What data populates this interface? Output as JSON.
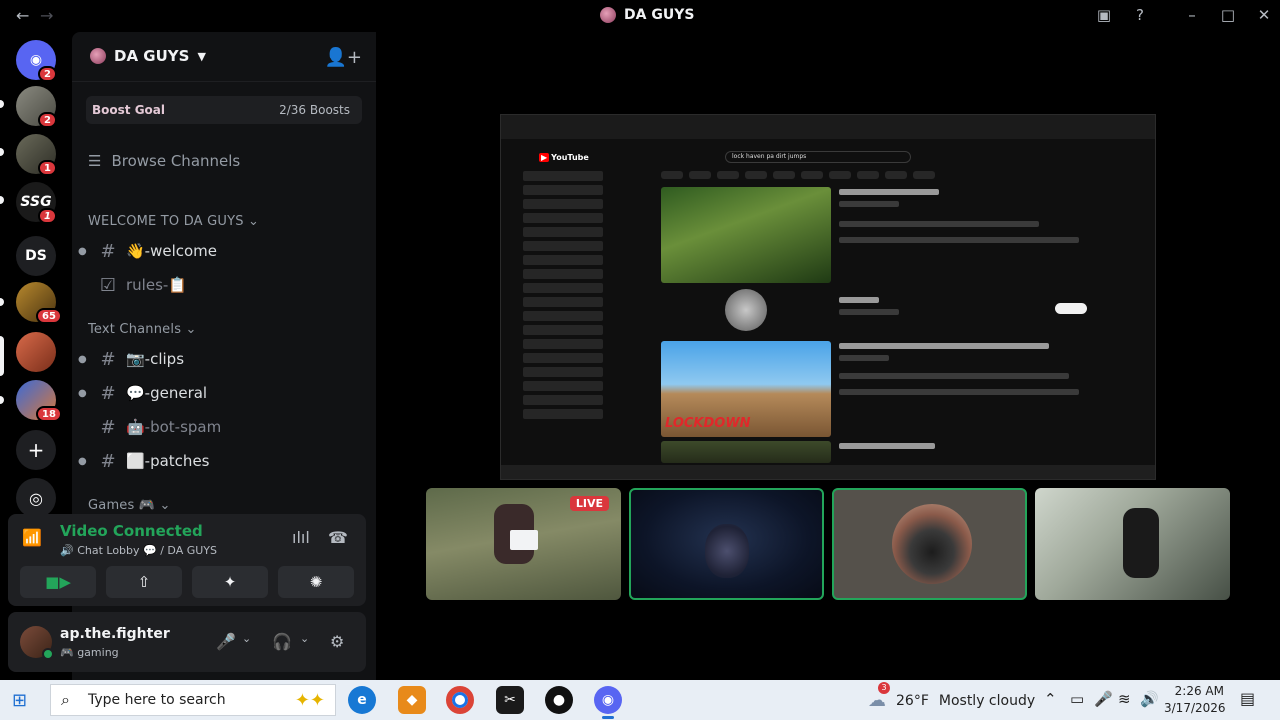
{
  "window": {
    "title": "DA GUYS"
  },
  "rail": {
    "badges": [
      "2",
      "2",
      "1",
      "1",
      "65",
      "18"
    ],
    "ds_label": "DS"
  },
  "guild": {
    "name": "DA GUYS",
    "boost": {
      "label": "Boost Goal",
      "count": "2/36 Boosts"
    },
    "browse": "Browse Channels",
    "categories": {
      "welcome": "WELCOME TO DA GUYS",
      "text": "Text Channels",
      "games": "Games 🎮"
    },
    "channels": [
      {
        "name": "👋-welcome"
      },
      {
        "name": "rules-📋"
      },
      {
        "name": "📷-clips"
      },
      {
        "name": "💬-general"
      },
      {
        "name": "🤖-bot-spam"
      },
      {
        "name": "⬜-patches"
      }
    ]
  },
  "voice": {
    "status": "Video Connected",
    "location": "🔊 Chat Lobby 💬 / DA GUYS"
  },
  "user": {
    "name": "ap.the.fighter",
    "status": "🎮 gaming"
  },
  "stage": {
    "live_label": "LIVE",
    "yt_search": "lock haven pa dirt jumps",
    "yt_episode": "LOCKDOWN"
  },
  "taskbar": {
    "search_placeholder": "Type here to search",
    "weather_temp": "26°F",
    "weather_desc": "Mostly cloudy",
    "weather_badge": "3",
    "time": "2:26 AM",
    "date": "3/17/2026"
  },
  "colors": {
    "accent_green": "#23a55a",
    "badge_red": "#da373c",
    "sidebar_bg": "#111214"
  }
}
